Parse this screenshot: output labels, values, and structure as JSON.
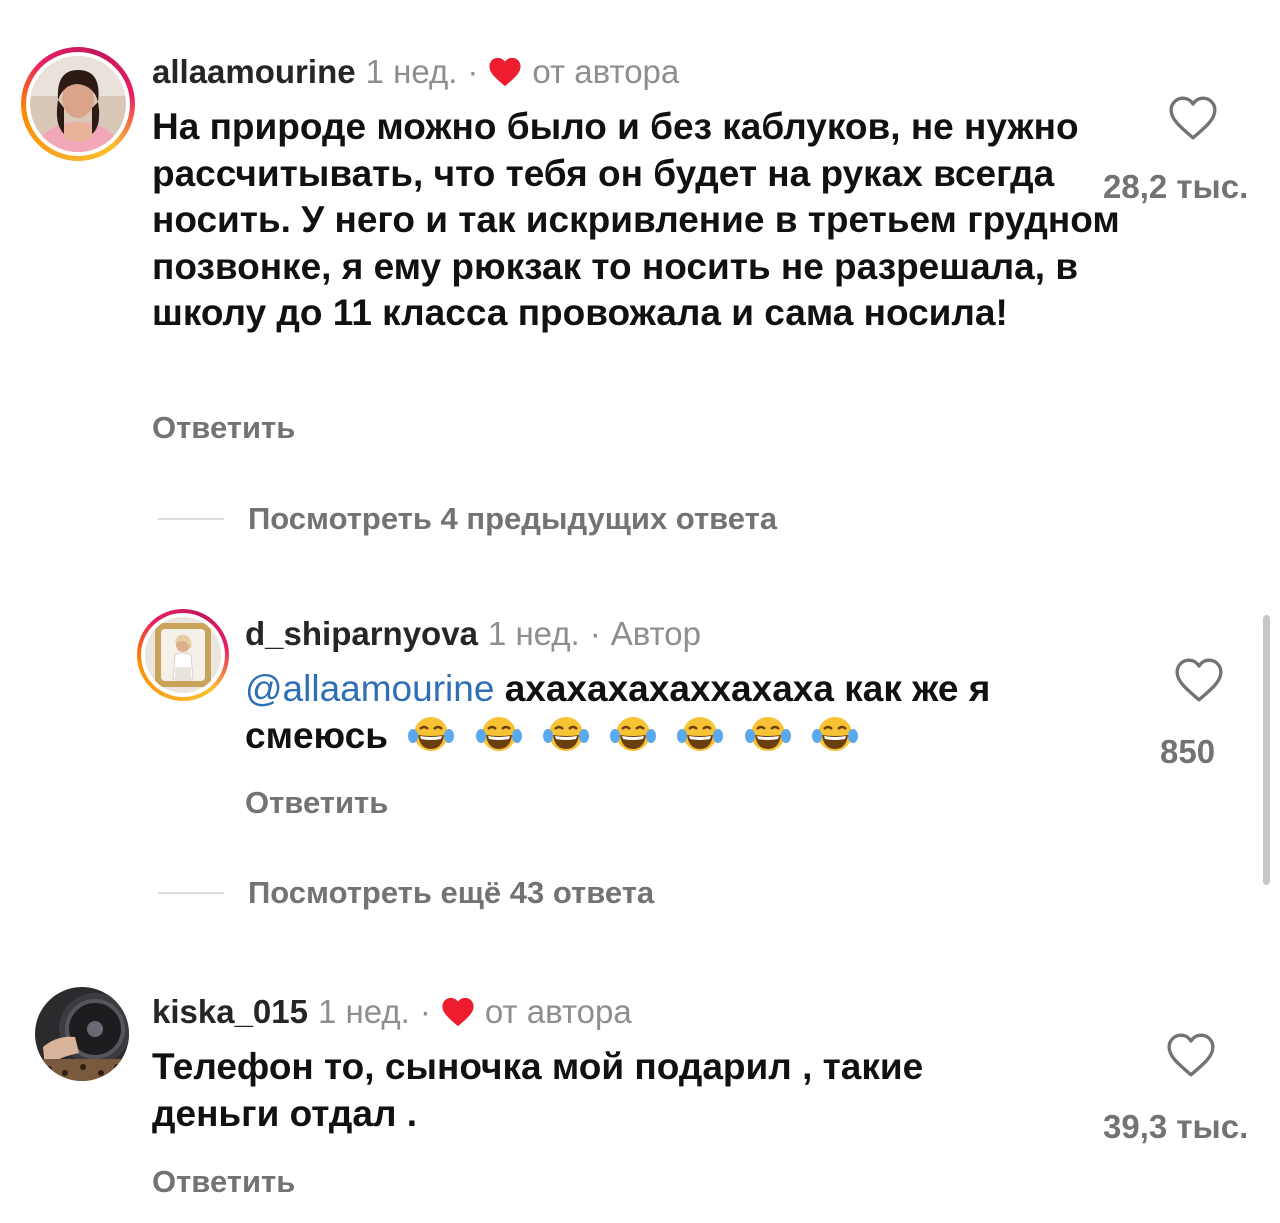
{
  "comments": [
    {
      "username": "allaamourine",
      "time": "1 нед.",
      "separator": "·",
      "badge": "от автора",
      "badge_icon": "red-heart-icon",
      "text": "На природе можно было и без каблуков, не нужно рассчитывать, что тебя он будет на руках всегда носить. У него и так искривление в третьем грудном позвонке, я ему рюкзак то носить не разрешала, в школу до 11 класса провожала и сама носила!",
      "reply_label": "Ответить",
      "likes": "28,2 тыс.",
      "like_icon": "heart-outline-icon",
      "view_replies": "Посмотреть 4 предыдущих ответа"
    },
    {
      "username": "d_shiparnyova",
      "time": "1 нед.",
      "separator": "·",
      "badge": "Автор",
      "mention": "@allaamourine",
      "text": "ахахахахаххахаха как же я смеюсь",
      "emoji": "😂😂😂😂😂😂😂",
      "reply_label": "Ответить",
      "likes": "850",
      "like_icon": "heart-outline-icon",
      "view_replies": "Посмотреть ещё 43 ответа"
    },
    {
      "username": "kiska_015",
      "time": "1 нед.",
      "separator": "·",
      "badge": "от автора",
      "badge_icon": "red-heart-icon",
      "text": "Телефон то, сыночка мой подарил , такие деньги отдал .",
      "reply_label": "Ответить",
      "likes": "39,3 тыс.",
      "like_icon": "heart-outline-icon"
    }
  ],
  "colors": {
    "username": "#262626",
    "meta": "#8e8e8e",
    "mention": "#2f6fb5",
    "heart_red": "#ed1c2e",
    "secondary": "#737373",
    "divider": "#dbdbdb"
  }
}
